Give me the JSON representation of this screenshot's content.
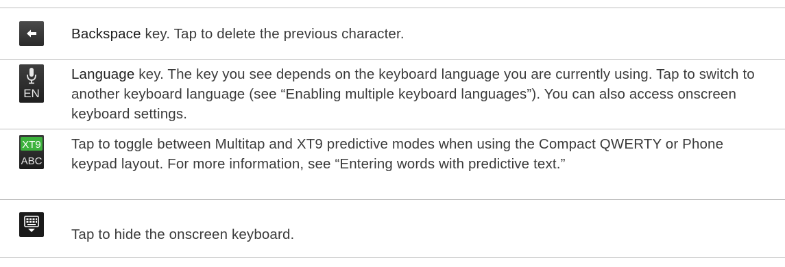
{
  "rows": [
    {
      "icon": "backspace-arrow-icon",
      "keyword": "Backspace",
      "text": " key. Tap to delete the previous character."
    },
    {
      "icon": "microphone-en-icon",
      "icon_label": "EN",
      "keyword": "Language",
      "text": " key. The key you see depends on the keyboard language you are currently using. Tap to switch to another keyboard language (see “Enabling multiple keyboard languages”). You can also access onscreen keyboard settings."
    },
    {
      "icon": "xt9-abc-icon",
      "icon_label_top": "XT9",
      "icon_label_bottom": "ABC",
      "text": "Tap to toggle between Multitap and XT9 predictive modes when using the Compact QWERTY or Phone keypad layout. For more information, see “Entering words with predictive text.”"
    },
    {
      "icon": "hide-keyboard-icon",
      "text": "Tap to hide the onscreen keyboard."
    }
  ],
  "colors": {
    "text": "#3a3a3a",
    "rule": "#bdbdbd",
    "xt9_green": "#3cb23c",
    "icon_bg": "#2a2a2a"
  }
}
